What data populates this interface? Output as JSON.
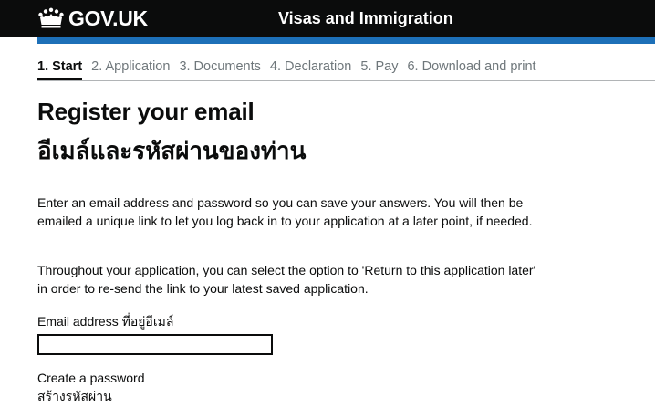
{
  "header": {
    "logo_text": "GOV.UK",
    "logo_icon": "crown-icon",
    "service_name": "Visas and Immigration",
    "brand_color": "#1d70b8",
    "background_color": "#0b0c0c"
  },
  "steps": [
    {
      "label": "1. Start",
      "current": true
    },
    {
      "label": "2. Application",
      "current": false
    },
    {
      "label": "3. Documents",
      "current": false
    },
    {
      "label": "4. Declaration",
      "current": false
    },
    {
      "label": "5. Pay",
      "current": false
    },
    {
      "label": "6. Download and print",
      "current": false
    }
  ],
  "main": {
    "title": "Register your email",
    "title_th": "อีเมล์และรหัสผ่านของท่าน",
    "paragraph1": "Enter an email address and password so you can save your answers. You will then be emailed a unique link to let you log back in to your application at a later point, if needed.",
    "paragraph2": "Throughout your application, you can select the option to 'Return to this application later' in order to re-send the link to your latest saved application."
  },
  "form": {
    "email_label": "Email address ที่อยู่อีเมล์",
    "email_value": "",
    "password_label": "Create a password",
    "password_label_th": "สร้างรหัสผ่าน"
  }
}
